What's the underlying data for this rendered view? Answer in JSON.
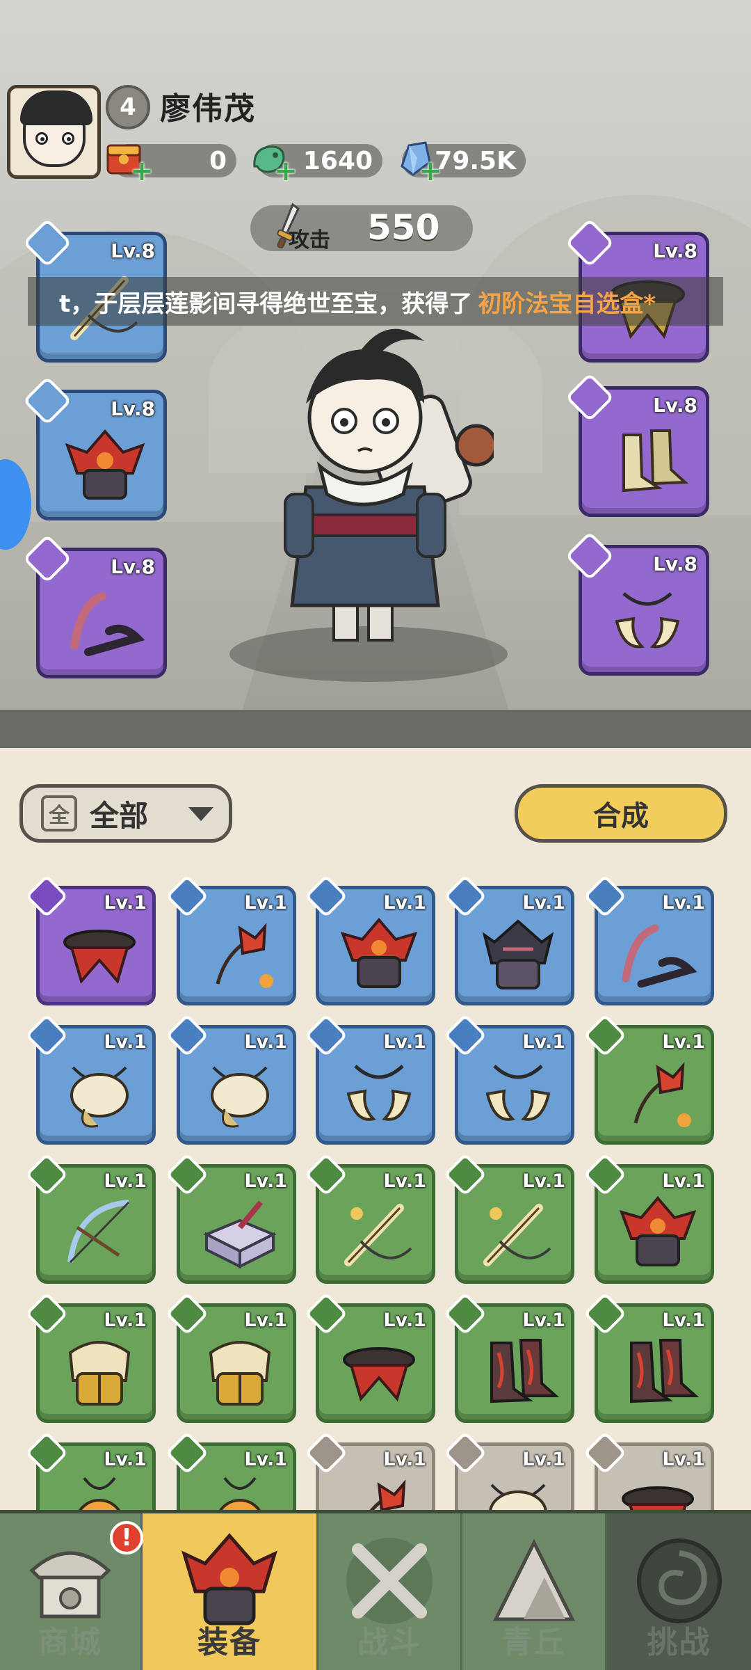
{
  "player": {
    "name": "廖伟茂",
    "level": "4"
  },
  "resources": [
    {
      "icon": "red-envelope-icon",
      "value": "0"
    },
    {
      "icon": "jade-dragon-icon",
      "value": "1640"
    },
    {
      "icon": "crystal-icon",
      "value": "79.5K"
    }
  ],
  "attack": {
    "label": "攻击",
    "value": "550"
  },
  "ticker": {
    "message": "t，于层层莲影间寻得绝世至宝，获得了",
    "highlight": "初阶法宝自选盒*"
  },
  "equipped": {
    "left": [
      {
        "level": "Lv.8",
        "rarity": "blue",
        "type": "weapon",
        "icon": "whip-icon"
      },
      {
        "level": "Lv.8",
        "rarity": "blue",
        "type": "armor",
        "icon": "lotus-armor-icon"
      },
      {
        "level": "Lv.8",
        "rarity": "purple",
        "type": "necklace",
        "icon": "claw-necklace-icon"
      }
    ],
    "right": [
      {
        "level": "Lv.8",
        "rarity": "purple",
        "type": "belt",
        "icon": "belt-icon"
      },
      {
        "level": "Lv.8",
        "rarity": "purple",
        "type": "boots",
        "icon": "bone-boots-icon"
      },
      {
        "level": "Lv.8",
        "rarity": "purple",
        "type": "ring",
        "icon": "fang-ring-icon"
      }
    ]
  },
  "filter": {
    "icon_char": "全",
    "label": "全部"
  },
  "synthesize_label": "合成",
  "inventory": [
    {
      "level": "Lv.1",
      "rarity": "purple",
      "icon": "belt-icon"
    },
    {
      "level": "Lv.1",
      "rarity": "blue",
      "icon": "flower-whip-icon"
    },
    {
      "level": "Lv.1",
      "rarity": "blue",
      "icon": "lotus-armor-icon"
    },
    {
      "level": "Lv.1",
      "rarity": "blue",
      "icon": "dark-armor-icon"
    },
    {
      "level": "Lv.1",
      "rarity": "blue",
      "icon": "claw-necklace-icon"
    },
    {
      "level": "Lv.1",
      "rarity": "blue",
      "icon": "shell-necklace-icon"
    },
    {
      "level": "Lv.1",
      "rarity": "blue",
      "icon": "shell-necklace-icon"
    },
    {
      "level": "Lv.1",
      "rarity": "blue",
      "icon": "fang-ring-icon"
    },
    {
      "level": "Lv.1",
      "rarity": "blue",
      "icon": "fang-ring-icon"
    },
    {
      "level": "Lv.1",
      "rarity": "green",
      "icon": "flower-whip-icon"
    },
    {
      "level": "Lv.1",
      "rarity": "green",
      "icon": "bow-icon"
    },
    {
      "level": "Lv.1",
      "rarity": "green",
      "icon": "box-icon"
    },
    {
      "level": "Lv.1",
      "rarity": "green",
      "icon": "whip-icon"
    },
    {
      "level": "Lv.1",
      "rarity": "green",
      "icon": "whip-icon"
    },
    {
      "level": "Lv.1",
      "rarity": "green",
      "icon": "lotus-armor-icon"
    },
    {
      "level": "Lv.1",
      "rarity": "green",
      "icon": "golden-armor-icon"
    },
    {
      "level": "Lv.1",
      "rarity": "green",
      "icon": "golden-armor-icon"
    },
    {
      "level": "Lv.1",
      "rarity": "green",
      "icon": "belt-icon"
    },
    {
      "level": "Lv.1",
      "rarity": "green",
      "icon": "flame-boots-icon"
    },
    {
      "level": "Lv.1",
      "rarity": "green",
      "icon": "flame-boots-icon"
    },
    {
      "level": "Lv.1",
      "rarity": "green",
      "icon": "fruit-ring-icon"
    },
    {
      "level": "Lv.1",
      "rarity": "green",
      "icon": "fruit-ring-icon"
    },
    {
      "level": "Lv.1",
      "rarity": "gray",
      "icon": "flower-whip-icon"
    },
    {
      "level": "Lv.1",
      "rarity": "gray",
      "icon": "shell-necklace-icon"
    },
    {
      "level": "Lv.1",
      "rarity": "gray",
      "icon": "belt-icon"
    }
  ],
  "nav": [
    {
      "label": "商城",
      "icon": "shop-icon",
      "state": "normal",
      "badge": "!"
    },
    {
      "label": "装备",
      "icon": "equipment-icon",
      "state": "active"
    },
    {
      "label": "战斗",
      "icon": "crossed-swords-icon",
      "state": "normal"
    },
    {
      "label": "青丘",
      "icon": "mountain-icon",
      "state": "normal"
    },
    {
      "label": "挑战",
      "icon": "vortex-icon",
      "state": "locked"
    }
  ],
  "colors": {
    "blue_rarity": "#6b9fd6",
    "purple_rarity": "#9469cf",
    "green_rarity": "#6aa35a",
    "gray_rarity": "#c6bfb4",
    "highlight_text": "#f4a444",
    "active_tab": "#f0c85c",
    "synth_button": "#f3cd5c"
  }
}
